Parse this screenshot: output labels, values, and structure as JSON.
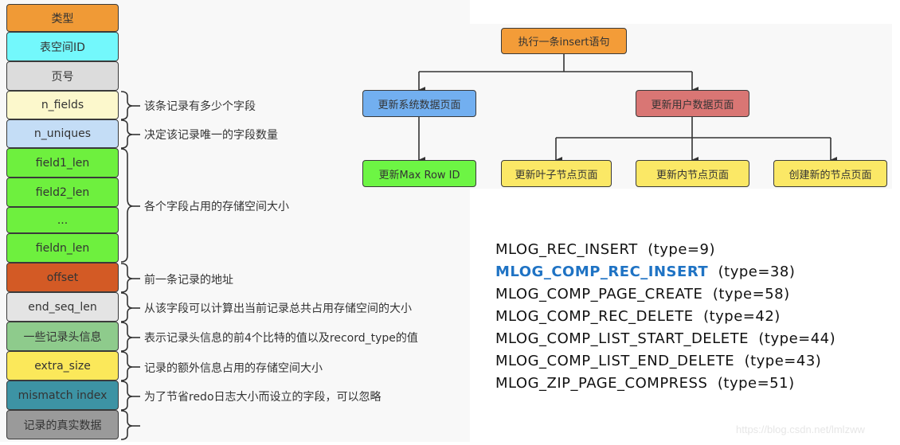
{
  "record_format": {
    "fields": [
      {
        "label": "类型",
        "color": "#f09a36"
      },
      {
        "label": "表空间ID",
        "color": "#73f8fc"
      },
      {
        "label": "页号",
        "color": "#dcdcdc"
      },
      {
        "label": "n_fields",
        "color": "#fcf8cc"
      },
      {
        "label": "n_uniques",
        "color": "#c4ddf6"
      },
      {
        "label": "field1_len",
        "color": "#6ef03e"
      },
      {
        "label": "field2_len",
        "color": "#6ef03e"
      },
      {
        "label": "...",
        "color": "#6ef03e"
      },
      {
        "label": "fieldn_len",
        "color": "#6ef03e"
      },
      {
        "label": "offset",
        "color": "#d35a25"
      },
      {
        "label": "end_seq_len",
        "color": "#e4e4e4"
      },
      {
        "label": "一些记录头信息",
        "color": "#8ecb8c"
      },
      {
        "label": "extra_size",
        "color": "#fbe85a"
      },
      {
        "label": "mismatch index",
        "color": "#3d93a4"
      },
      {
        "label": "记录的真实数据",
        "color": "#9a9a9a"
      }
    ],
    "annotations": [
      {
        "text": "该条记录有多少个字段"
      },
      {
        "text": "决定该记录唯一的字段数量"
      },
      {
        "text": "各个字段占用的存储空间大小"
      },
      {
        "text": "前一条记录的地址"
      },
      {
        "text": "从该字段可以计算出当前记录总共占用存储空间的大小"
      },
      {
        "text": "表示记录头信息的前4个比特的值以及record_type的值"
      },
      {
        "text": "记录的额外信息占用的存储空间大小"
      },
      {
        "text": "为了节省redo日志大小而设立的字段，可以忽略"
      },
      {
        "text": ""
      }
    ]
  },
  "flowchart": {
    "root": {
      "label": "执行一条insert语句",
      "color": "#f39c38"
    },
    "system_page": {
      "label": "更新系统数据页面",
      "color": "#72aff0"
    },
    "user_page": {
      "label": "更新用户数据页面",
      "color": "#d97674"
    },
    "max_row_id": {
      "label": "更新Max Row ID",
      "color": "#6df544"
    },
    "leaf_page": {
      "label": "更新叶子节点页面",
      "color": "#fbe866"
    },
    "inner_page": {
      "label": "更新内节点页面",
      "color": "#fbe866"
    },
    "new_page": {
      "label": "创建新的节点页面",
      "color": "#fbe866"
    }
  },
  "mlog_types": [
    {
      "name": "MLOG_REC_INSERT",
      "type": "(type=9)",
      "highlight": false
    },
    {
      "name": "MLOG_COMP_REC_INSERT",
      "type": "(type=38)",
      "highlight": true
    },
    {
      "name": "MLOG_COMP_PAGE_CREATE",
      "type": "(type=58)",
      "highlight": false
    },
    {
      "name": "MLOG_COMP_REC_DELETE",
      "type": "(type=42)",
      "highlight": false
    },
    {
      "name": "MLOG_COMP_LIST_START_DELETE",
      "type": "(type=44)",
      "highlight": false
    },
    {
      "name": "MLOG_COMP_LIST_END_DELETE",
      "type": "(type=43)",
      "highlight": false
    },
    {
      "name": "MLOG_ZIP_PAGE_COMPRESS",
      "type": "(type=51)",
      "highlight": false
    }
  ],
  "highlight_color": "#1f73c4",
  "watermark": "https://blog.csdn.net/lmlzww"
}
